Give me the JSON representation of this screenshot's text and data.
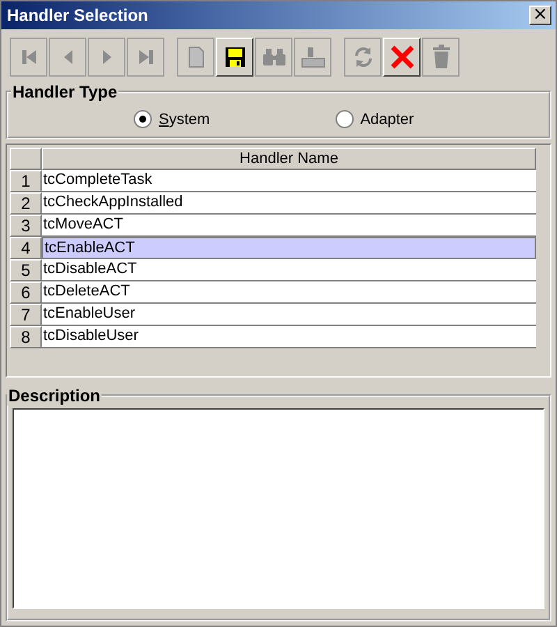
{
  "window": {
    "title": "Handler Selection",
    "close": "×"
  },
  "toolbar": [
    [
      {
        "kind": "first",
        "disabled": true
      },
      {
        "kind": "prev",
        "disabled": true
      },
      {
        "kind": "next",
        "disabled": true
      },
      {
        "kind": "last",
        "disabled": true
      }
    ],
    [
      {
        "kind": "new",
        "disabled": true
      },
      {
        "kind": "save",
        "disabled": false
      },
      {
        "kind": "find",
        "disabled": true
      },
      {
        "kind": "stamp",
        "disabled": true
      }
    ],
    [
      {
        "kind": "refresh",
        "disabled": true
      },
      {
        "kind": "delete",
        "disabled": false
      },
      {
        "kind": "trash",
        "disabled": true
      }
    ]
  ],
  "handler_type": {
    "title": "Handler Type",
    "options": [
      {
        "label": "System",
        "selected": true,
        "mnemonic": true
      },
      {
        "label": "Adapter",
        "selected": false,
        "mnemonic": false
      }
    ]
  },
  "table": {
    "columns": [
      "Handler Name"
    ],
    "rows": [
      {
        "number": "1",
        "name": "tcCompleteTask",
        "selected": false
      },
      {
        "number": "2",
        "name": "tcCheckAppInstalled",
        "selected": false
      },
      {
        "number": "3",
        "name": "tcMoveACT",
        "selected": false
      },
      {
        "number": "4",
        "name": "tcEnableACT",
        "selected": true
      },
      {
        "number": "5",
        "name": "tcDisableACT",
        "selected": false
      },
      {
        "number": "6",
        "name": "tcDeleteACT",
        "selected": false
      },
      {
        "number": "7",
        "name": "tcEnableUser",
        "selected": false
      },
      {
        "number": "8",
        "name": "tcDisableUser",
        "selected": false
      }
    ]
  },
  "description": {
    "title": "Description"
  }
}
